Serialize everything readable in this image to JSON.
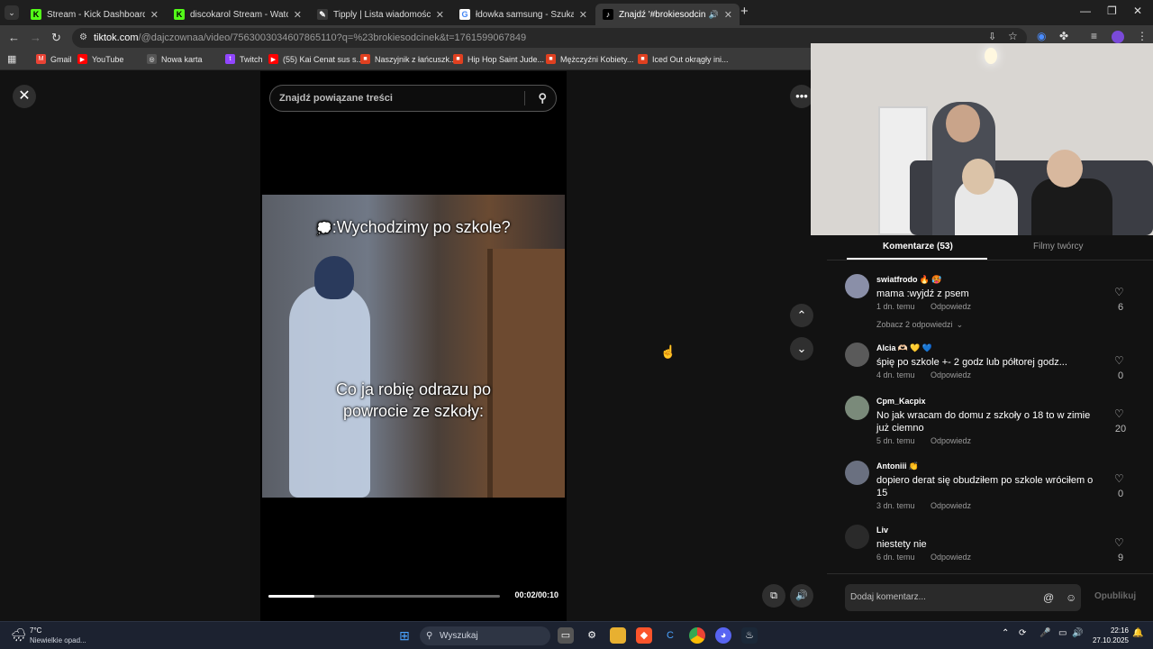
{
  "tabs": [
    {
      "title": "Stream - Kick Dashboard",
      "favicon": "kick-icon",
      "color": "#53fc18",
      "glyph": "K"
    },
    {
      "title": "discokarol Stream - Watch Live",
      "favicon": "kick-icon",
      "color": "#53fc18",
      "glyph": "K"
    },
    {
      "title": "Tipply | Lista wiadomości",
      "favicon": "tipply-icon",
      "color": "#3a3a3a",
      "glyph": "✎"
    },
    {
      "title": "łdowka samsung - Szukaj w Go",
      "favicon": "google-icon",
      "color": "#ffffff",
      "glyph": "G"
    },
    {
      "title": "Znajdź '#brokiesodcinek' n",
      "favicon": "tiktok-icon",
      "color": "#000000",
      "glyph": "♪"
    }
  ],
  "address": {
    "host": "tiktok.com",
    "path": "/@dajczownaa/video/7563003034607865110?q=%23brokiesodcinek&t=1761599067849"
  },
  "bookmarks": [
    {
      "label": "Gmail",
      "color": "#ea4335",
      "glyph": "M"
    },
    {
      "label": "YouTube",
      "color": "#ff0000",
      "glyph": "▶"
    },
    {
      "label": "Nowa karta",
      "color": "#555555",
      "glyph": "◎"
    },
    {
      "label": "Twitch",
      "color": "#9146ff",
      "glyph": "t"
    },
    {
      "label": "(55) Kai Cenat sus s...",
      "color": "#ff0000",
      "glyph": "▶"
    },
    {
      "label": "Naszyjnik z łańcuszk...",
      "color": "#e04020",
      "glyph": "■"
    },
    {
      "label": "Hip Hop Saint Jude...",
      "color": "#e04020",
      "glyph": "■"
    },
    {
      "label": "Mężczyźni Kobiety...",
      "color": "#e04020",
      "glyph": "■"
    },
    {
      "label": "Iced Out okrągły ini...",
      "color": "#e04020",
      "glyph": "■"
    }
  ],
  "viewer": {
    "search_placeholder": "Znajdź powiązane treści",
    "caption_top": ":Wychodzimy po szkole?",
    "caption_mid": "Co ja robię odrazu po powrocie ze szkoły:",
    "time": "00:02/00:10",
    "progress": 0.2
  },
  "comments_panel": {
    "tab_comments": "Komentarze (53)",
    "tab_creator": "Filmy twórcy",
    "reply_label": "Odpowiedz",
    "comments": [
      {
        "user": "swiatfrodo",
        "emoji": "🔥 🥵",
        "text": "mama :wyjdź z psem",
        "time": "1 dn. temu",
        "likes": "6",
        "more": "Zobacz 2 odpowiedzi"
      },
      {
        "user": "Alcia",
        "emoji": "🫶🏻 💛 💙",
        "text": "śpię po szkole +- 2 godz lub półtorej godz...",
        "time": "4 dn. temu",
        "likes": "0"
      },
      {
        "user": "Cpm_Kacpix",
        "emoji": "",
        "text": "No jak wracam do domu z szkoły o 18 to w zimie już ciemno",
        "time": "5 dn. temu",
        "likes": "20"
      },
      {
        "user": "Antoniii",
        "emoji": "👏",
        "text": "dopiero derat się obudziłem po szkole wróciłem o 15",
        "time": "3 dn. temu",
        "likes": "0"
      },
      {
        "user": "Liv",
        "emoji": "",
        "text": "niestety nie",
        "time": "6 dn. temu",
        "likes": "9"
      }
    ],
    "input_placeholder": "Dodaj komentarz...",
    "post_label": "Opublikuj"
  },
  "taskbar": {
    "weather_temp": "7°C",
    "weather_desc": "Niewielkie opad...",
    "search_label": "Wyszukaj",
    "time": "22:16",
    "date": "27.10.2025"
  }
}
